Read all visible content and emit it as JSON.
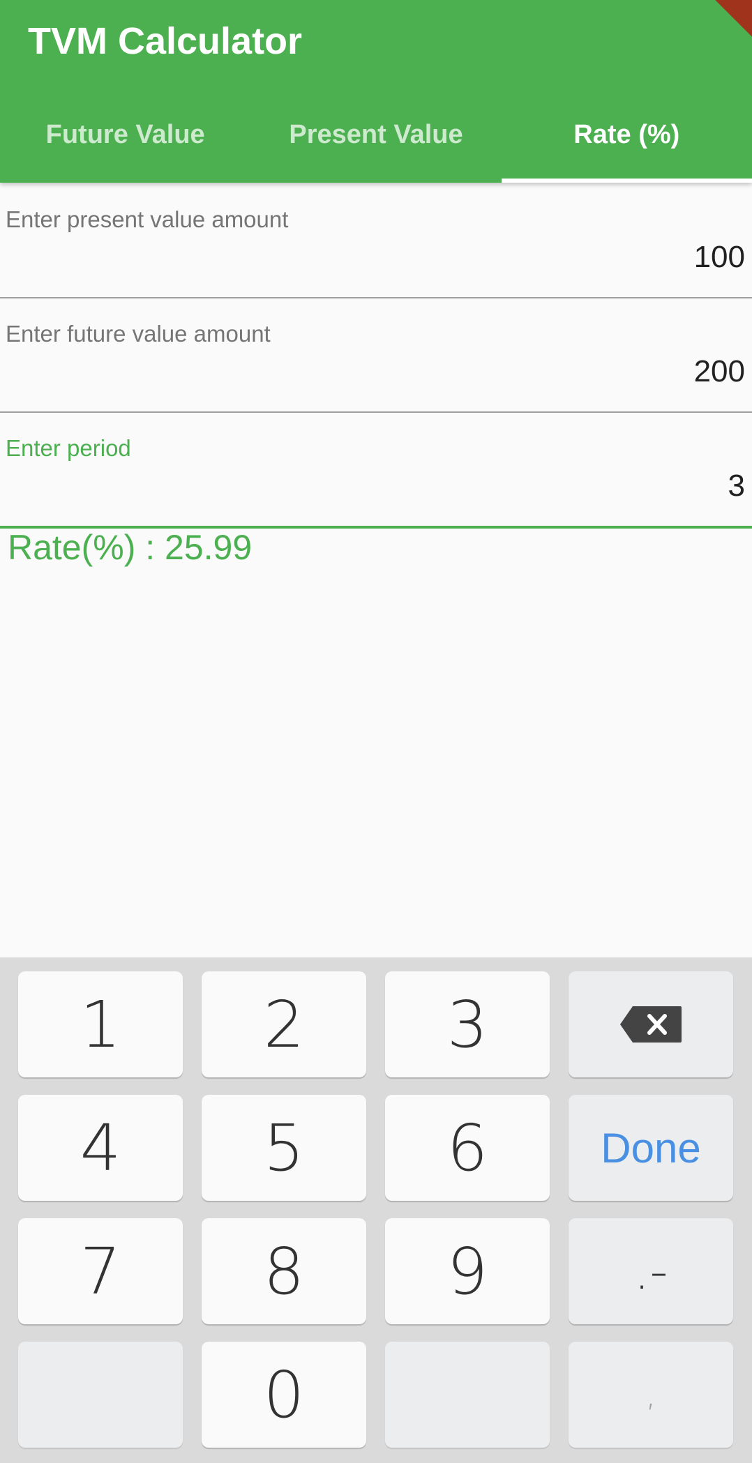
{
  "app": {
    "title": "TVM Calculator",
    "accent_color": "#4CAF50"
  },
  "tabs": [
    {
      "label": "Future Value",
      "active": false
    },
    {
      "label": "Present Value",
      "active": false
    },
    {
      "label": "Rate (%)",
      "active": true
    }
  ],
  "form": {
    "present_value": {
      "label": "Enter present value amount",
      "value": "100"
    },
    "future_value": {
      "label": "Enter future value amount",
      "value": "200"
    },
    "period": {
      "label": "Enter period",
      "value": "3",
      "focused": true
    }
  },
  "result": {
    "text": "Rate(%) : 25.99"
  },
  "keyboard": {
    "keys": {
      "k1": "1",
      "k2": "2",
      "k3": "3",
      "k4": "4",
      "k5": "5",
      "k6": "6",
      "k7": "7",
      "k8": "8",
      "k9": "9",
      "k0": "0",
      "done": "Done",
      "dot_minus": ".-",
      "comma": ","
    },
    "backspace_icon": "backspace-icon",
    "done_color": "#4A90E2"
  }
}
